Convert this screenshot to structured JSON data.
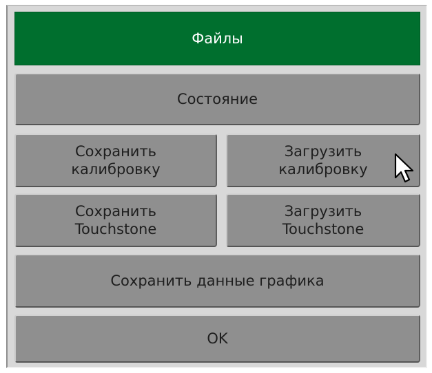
{
  "dialog": {
    "title": "Файлы",
    "buttons": {
      "state": "Состояние",
      "save_calibration": "Сохранить\nкалибровку",
      "load_calibration": "Загрузить\nкалибровку",
      "save_touchstone": "Сохранить\nTouchstone",
      "load_touchstone": "Загрузить\nTouchstone",
      "save_chart_data": "Сохранить данные графика",
      "ok": "OK"
    }
  },
  "colors": {
    "title_bg": "#006f2e",
    "button_bg": "#8f8f8f",
    "panel_bg": "#d8d8d8"
  },
  "icons": {
    "cursor": "mouse-pointer-icon"
  }
}
